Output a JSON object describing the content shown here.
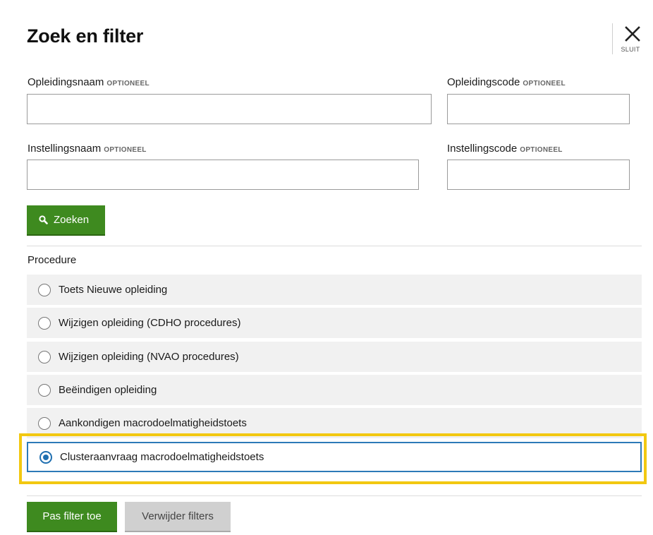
{
  "dialog": {
    "title": "Zoek en filter",
    "close_label": "SLUIT",
    "close_icon": "close-icon"
  },
  "fields": {
    "opleidingsnaam": {
      "label": "Opleidingsnaam",
      "optional": "OPTIONEEL",
      "value": "",
      "placeholder": ""
    },
    "opleidingscode": {
      "label": "Opleidingscode",
      "optional": "OPTIONEEL",
      "value": "",
      "placeholder": ""
    },
    "instellingsnaam": {
      "label": "Instellingsnaam",
      "optional": "OPTIONEEL",
      "value": "",
      "placeholder": ""
    },
    "instellingscode": {
      "label": "Instellingscode",
      "optional": "OPTIONEEL",
      "value": "",
      "placeholder": ""
    }
  },
  "search_button": {
    "label": "Zoeken",
    "icon": "search-icon"
  },
  "procedure": {
    "label": "Procedure",
    "options": [
      {
        "label": "Toets Nieuwe opleiding",
        "selected": false
      },
      {
        "label": "Wijzigen opleiding (CDHO procedures)",
        "selected": false
      },
      {
        "label": "Wijzigen opleiding (NVAO procedures)",
        "selected": false
      },
      {
        "label": "Beëindigen opleiding",
        "selected": false
      },
      {
        "label": "Aankondigen macrodoelmatigheidstoets",
        "selected": false
      },
      {
        "label": "Clusteraanvraag macrodoelmatigheidstoets",
        "selected": true
      }
    ]
  },
  "footer": {
    "apply_label": "Pas filter toe",
    "clear_label": "Verwijder filters"
  },
  "colors": {
    "primary_green": "#3e8a1f",
    "selected_blue": "#1f6fb0",
    "focus_yellow": "#f2c811",
    "row_background": "#f1f1f1"
  }
}
